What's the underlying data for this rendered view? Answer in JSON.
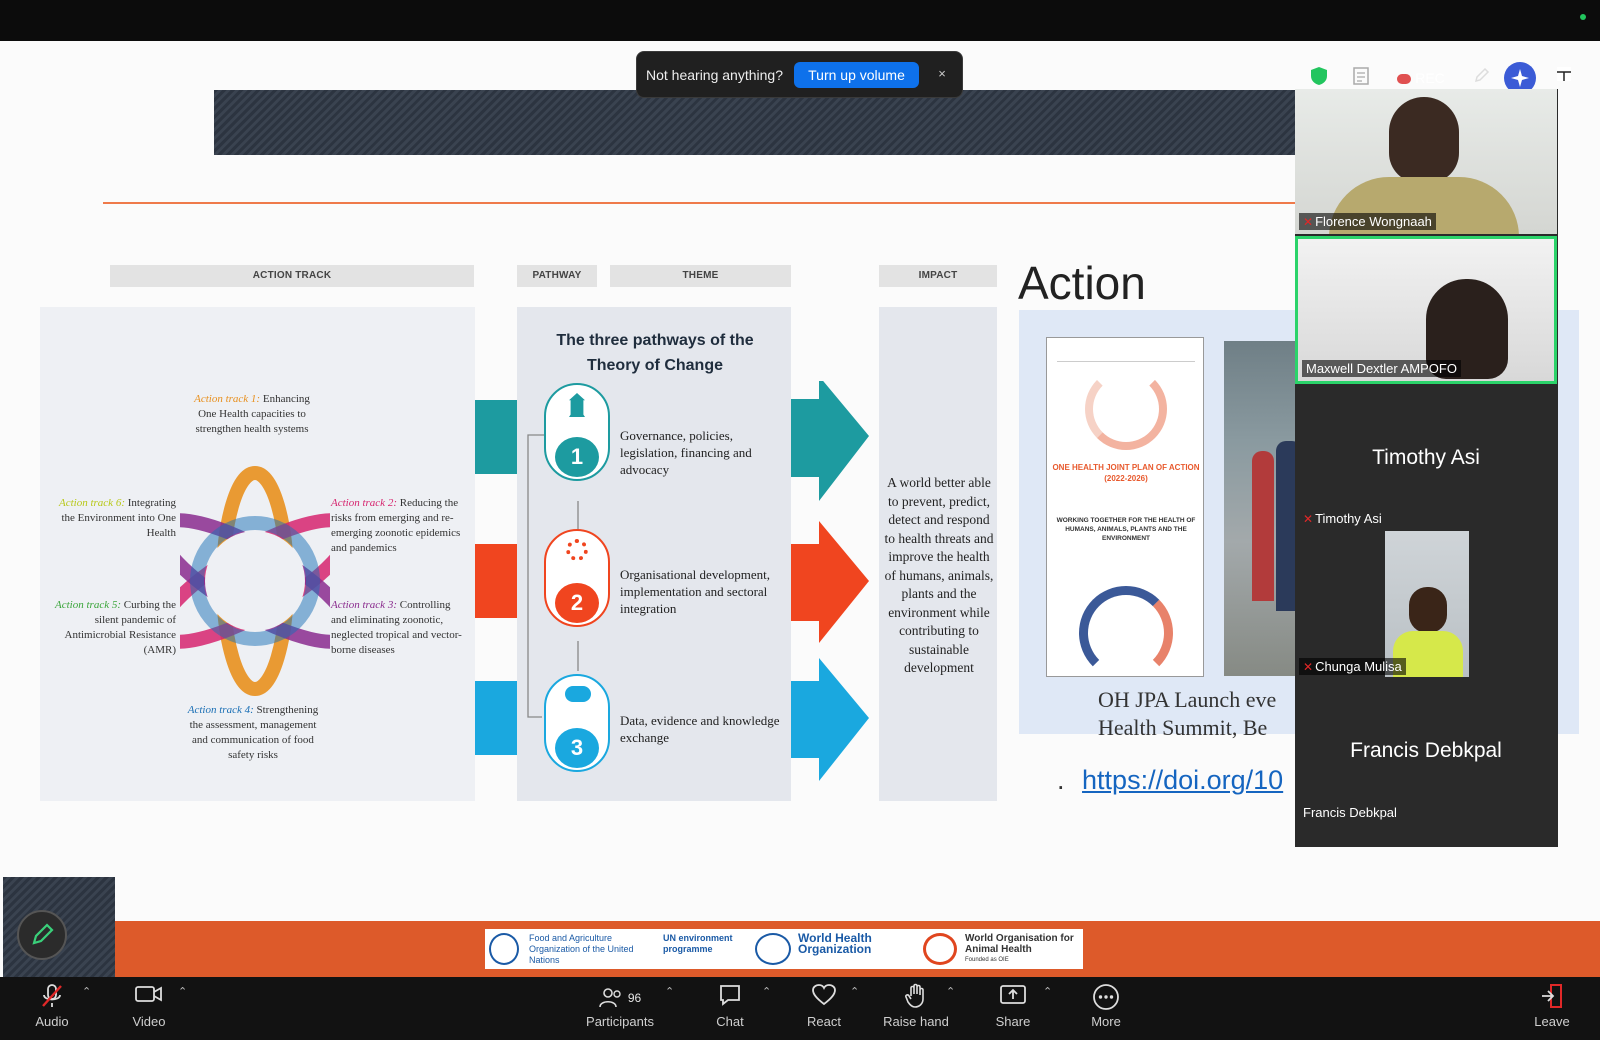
{
  "banner": {
    "message": "Not hearing anything?",
    "action": "Turn up volume",
    "close": "×"
  },
  "top_tools": {
    "rec_label": "REC"
  },
  "slide": {
    "headers": [
      "ACTION TRACK",
      "PATHWAY",
      "THEME",
      "IMPACT"
    ],
    "action_tracks": [
      {
        "label": "Action track 1:",
        "text": "Enhancing One Health capacities to strengthen health systems",
        "color": "#e8901e"
      },
      {
        "label": "Action track 2:",
        "text": "Reducing the risks from emerging and re-emerging zoonotic epidemics and pandemics",
        "color": "#d6246e"
      },
      {
        "label": "Action track 3:",
        "text": "Controlling and eliminating zoonotic, neglected tropical and vector-borne diseases",
        "color": "#8a2c8e"
      },
      {
        "label": "Action track 4:",
        "text": "Strengthening the assessment, management and communication of food safety risks",
        "color": "#1a6fb5"
      },
      {
        "label": "Action track 5:",
        "text": "Curbing the silent pandemic of Antimicrobial Resistance (AMR)",
        "color": "#3aa53a"
      },
      {
        "label": "Action track 6:",
        "text": "Integrating the Environment into One Health",
        "color": "#b8c818"
      }
    ],
    "pathways_title": "The three pathways of the Theory of Change",
    "pathways": [
      {
        "number": "1",
        "text": "Governance, policies, legislation, financing and advocacy",
        "color": "#1d9ba0"
      },
      {
        "number": "2",
        "text": "Organisational development, implementation and sectoral integration",
        "color": "#f0451f"
      },
      {
        "number": "3",
        "text": "Data, evidence and knowledge exchange",
        "color": "#1aa8df"
      }
    ],
    "impact_text": "A world better able to prevent, predict, detect and respond to health threats and improve the health of humans, animals, plants and the environment while contributing to sustainable development",
    "action_title": "Action",
    "cover": {
      "title": "ONE HEALTH JOINT PLAN OF ACTION (2022-2026)",
      "subtitle": "WORKING TOGETHER FOR THE HEALTH OF HUMANS, ANIMALS, PLANTS AND THE ENVIRONMENT"
    },
    "caption_line1": "OH JPA Launch eve",
    "caption_line2": "Health Summit, Be",
    "doi_bullet": ".",
    "doi_link": "https://doi.org/10",
    "logos": [
      {
        "text": "Food and Agriculture Organization of the United Nations"
      },
      {
        "text": "UN environment programme"
      },
      {
        "text": "World Health Organization"
      },
      {
        "text": "World Organisation for Animal Health"
      }
    ],
    "logo_subtext": "Founded as OIE"
  },
  "participants_panel": [
    {
      "name": "Florence Wongnaah",
      "muted": true,
      "has_video": true
    },
    {
      "name": "Maxwell Dextler AMPOFO",
      "muted": false,
      "has_video": true,
      "active_speaker": true
    },
    {
      "name": "Timothy Asi",
      "muted": true,
      "has_video": false,
      "display_name": "Timothy Asi"
    },
    {
      "name": "Chunga Mulisa",
      "muted": true,
      "has_video": true
    },
    {
      "name": "Francis Debkpal",
      "muted": false,
      "has_video": false,
      "display_name": "Francis Debkpal"
    }
  ],
  "toolbar": {
    "audio": "Audio",
    "video": "Video",
    "participants": "Participants",
    "participants_count": "96",
    "chat": "Chat",
    "react": "React",
    "raise_hand": "Raise hand",
    "share": "Share",
    "more": "More",
    "leave": "Leave"
  }
}
